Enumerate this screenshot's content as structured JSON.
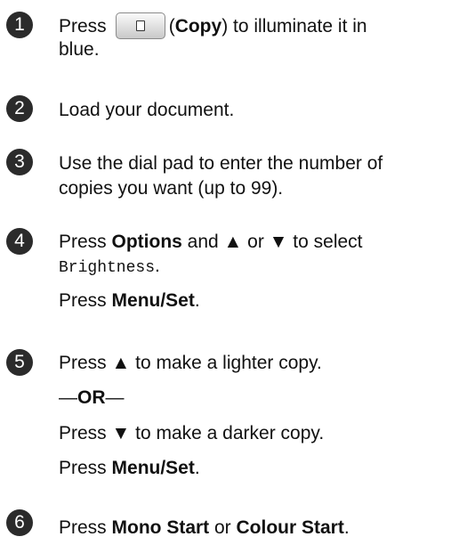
{
  "steps": [
    {
      "number": "1",
      "lines": [
        {
          "pre": "Press",
          "button_label": "Copy",
          "post": ") to illuminate it in"
        },
        {
          "text": "blue."
        }
      ]
    },
    {
      "number": "2",
      "lines": [
        {
          "text": "Load your document."
        }
      ]
    },
    {
      "number": "3",
      "lines": [
        {
          "text": "Use the dial pad to enter the number of"
        },
        {
          "text": "copies you want (up to 99)."
        }
      ]
    },
    {
      "number": "4",
      "lines": [
        {
          "p1": "Press ",
          "b1": "Options",
          "p2": " and ▲ or ▼ to select"
        },
        {
          "mono": "Brightness",
          "tail": "."
        },
        {
          "p1": "Press ",
          "b1": "Menu/Set",
          "p2": "."
        }
      ]
    },
    {
      "number": "5",
      "lines": [
        {
          "text": "Press ▲ to make a lighter copy."
        },
        {
          "dash1": "—",
          "or": "OR",
          "dash2": "—"
        },
        {
          "text": "Press ▼ to make a darker copy."
        },
        {
          "p1": "Press ",
          "b1": "Menu/Set",
          "p2": "."
        }
      ]
    },
    {
      "number": "6",
      "lines": [
        {
          "p1": "Press ",
          "b1": "Mono Start",
          "p2": " or ",
          "b2": "Colour Start",
          "p3": "."
        }
      ]
    }
  ],
  "icons": {
    "copy_button": "copy-document-icon"
  },
  "colors": {
    "step_badge": "#2b2b2b",
    "text": "#111111"
  }
}
